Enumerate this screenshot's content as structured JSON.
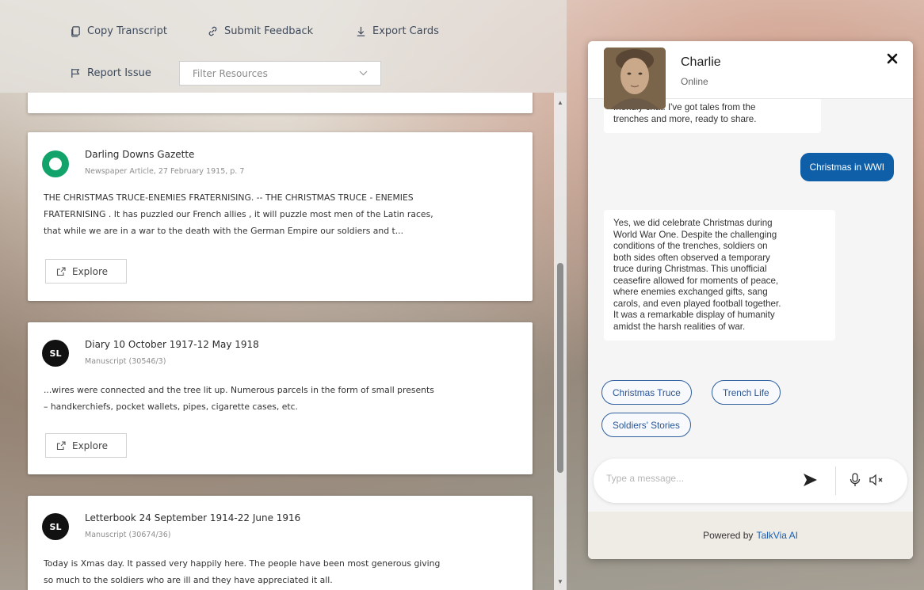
{
  "toolbar": {
    "copy_transcript": "Copy Transcript",
    "submit_feedback": "Submit Feedback",
    "export_cards": "Export Cards",
    "report_issue": "Report Issue",
    "filter_placeholder": "Filter Resources"
  },
  "cards": [
    {
      "source_logo": "trove-logo",
      "title": "Darling Downs Gazette",
      "subtitle": "Newspaper Article, 27 February 1915, p. 7",
      "body_lines": [
        "THE CHRISTMAS TRUCE-ENEMIES FRATERNISING. -- THE CHRISTMAS TRUCE - ENEMIES",
        "FRATERNISING . It has puzzled our French allies , it will puzzle most men of the Latin races,",
        "that while we are in a war to the death with the German Empire our soldiers and t..."
      ],
      "action": "Explore"
    },
    {
      "source_logo": "SL",
      "title": "Diary 10 October 1917-12 May 1918",
      "subtitle": "Manuscript (30546/3)",
      "body_lines": [
        "...wires were connected and the tree lit up. Numerous parcels in the form of small presents",
        "– handkerchiefs, pocket wallets, pipes, cigarette cases, etc."
      ],
      "action": "Explore"
    },
    {
      "source_logo": "SL",
      "title": "Letterbook 24 September 1914-22 June 1916",
      "subtitle": "Manuscript (30674/36)",
      "body_lines": [
        "Today is Xmas day. It passed very happily here. The people have been most generous giving",
        "so much to the soldiers who are ill and they have appreciated it all."
      ]
    }
  ],
  "chat": {
    "agent_name": "Charlie",
    "agent_status": "Online",
    "messages": {
      "bot_1_lines": [
        "friendly chat. I've got tales from the",
        "trenches and more, ready to share."
      ],
      "user_1": "Christmas in WWI",
      "bot_2_lines": [
        "Yes, we did celebrate Christmas during",
        "World War One. Despite the challenging",
        "conditions of the trenches, soldiers on",
        "both sides often observed a temporary",
        "truce during Christmas. This unofficial",
        "ceasefire allowed for moments of peace,",
        "where enemies exchanged gifts, sang",
        "carols, and even played football together.",
        "It was a remarkable display of humanity",
        "amidst the harsh realities of war."
      ]
    },
    "suggestions": [
      "Christmas Truce",
      "Trench Life",
      "Soldiers' Stories"
    ],
    "input_placeholder": "Type a message...",
    "footer_prefix": "Powered by",
    "footer_brand": "TalkVia AI"
  },
  "colors": {
    "user_bubble": "#0f5fa8",
    "chip_border": "#2f5f9c",
    "brand_link": "#1a5fb4",
    "trove_green": "#12a36a"
  }
}
